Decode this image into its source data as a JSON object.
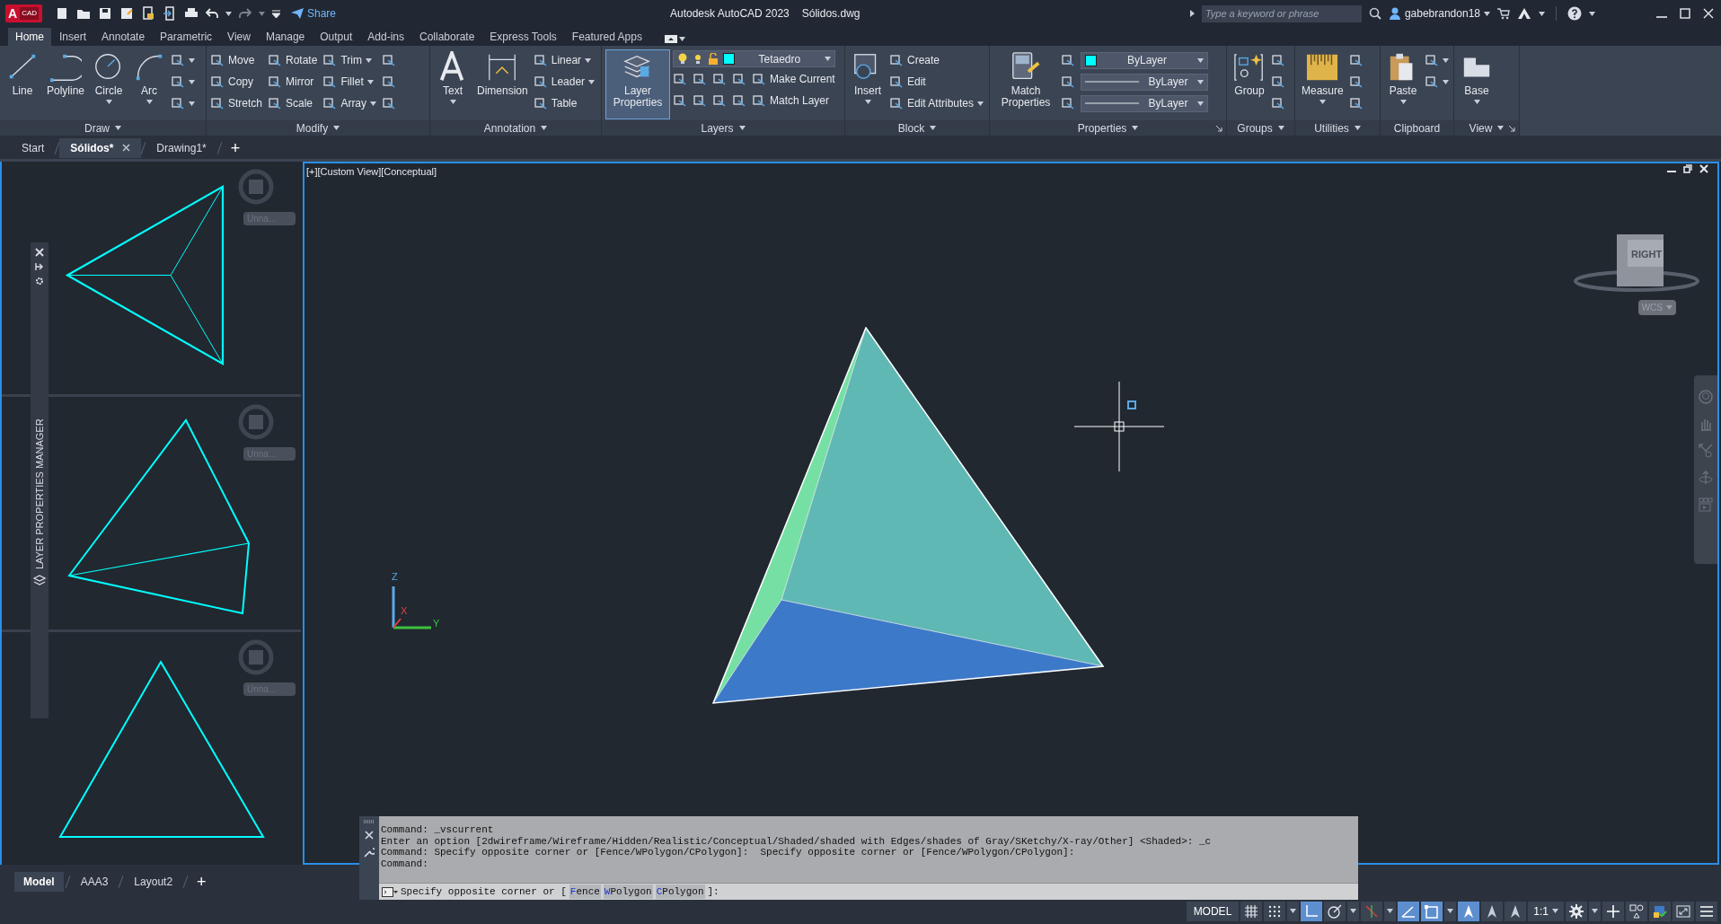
{
  "title_bar": {
    "app_letter": "A",
    "app_label": "CAD",
    "share": "Share",
    "title": "Autodesk AutoCAD 2023",
    "file": "Sólidos.dwg",
    "search_placeholder": "Type a keyword or phrase",
    "user": "gabebrandon18"
  },
  "ribbon_tabs": [
    {
      "label": "Home",
      "selected": true
    },
    {
      "label": "Insert",
      "selected": false
    },
    {
      "label": "Annotate",
      "selected": false
    },
    {
      "label": "Parametric",
      "selected": false
    },
    {
      "label": "View",
      "selected": false
    },
    {
      "label": "Manage",
      "selected": false
    },
    {
      "label": "Output",
      "selected": false
    },
    {
      "label": "Add-ins",
      "selected": false
    },
    {
      "label": "Collaborate",
      "selected": false
    },
    {
      "label": "Express Tools",
      "selected": false
    },
    {
      "label": "Featured Apps",
      "selected": false
    }
  ],
  "ribbon_panels": [
    {
      "title": "Draw",
      "title_dropdown": true,
      "launcher": false,
      "large": [
        {
          "label": "Line",
          "dropdown": false,
          "selected": false
        },
        {
          "label": "Polyline",
          "dropdown": false,
          "selected": false
        },
        {
          "label": "Circle",
          "dropdown": true,
          "selected": false
        },
        {
          "label": "Arc",
          "dropdown": true,
          "selected": false
        }
      ],
      "rows": [
        [
          {
            "kind": "icon",
            "dropdown": true
          }
        ],
        [
          {
            "kind": "icon",
            "dropdown": true
          }
        ],
        [
          {
            "kind": "icon",
            "dropdown": true
          }
        ]
      ]
    },
    {
      "title": "Modify",
      "title_dropdown": true,
      "launcher": false,
      "rows": [
        [
          {
            "kind": "tool",
            "label": "Move",
            "dropdown": false
          },
          {
            "kind": "tool",
            "label": "Rotate",
            "dropdown": false
          },
          {
            "kind": "tool",
            "label": "Trim",
            "dropdown": true
          },
          {
            "kind": "icon",
            "dropdown": false
          }
        ],
        [
          {
            "kind": "tool",
            "label": "Copy",
            "dropdown": false
          },
          {
            "kind": "tool",
            "label": "Mirror",
            "dropdown": false
          },
          {
            "kind": "tool",
            "label": "Fillet",
            "dropdown": true
          },
          {
            "kind": "icon",
            "dropdown": false
          }
        ],
        [
          {
            "kind": "tool",
            "label": "Stretch",
            "dropdown": false
          },
          {
            "kind": "tool",
            "label": "Scale",
            "dropdown": false
          },
          {
            "kind": "tool",
            "label": "Array",
            "dropdown": true
          },
          {
            "kind": "icon",
            "dropdown": false
          }
        ]
      ]
    },
    {
      "title": "Annotation",
      "title_dropdown": true,
      "launcher": false,
      "large": [
        {
          "label": "Text",
          "dropdown": true,
          "selected": false
        },
        {
          "label": "Dimension",
          "dropdown": false,
          "selected": false
        }
      ],
      "rows": [
        [
          {
            "kind": "tool",
            "label": "Linear",
            "dropdown": true
          }
        ],
        [
          {
            "kind": "tool",
            "label": "Leader",
            "dropdown": true
          }
        ],
        [
          {
            "kind": "tool",
            "label": "Table",
            "dropdown": false
          }
        ]
      ]
    },
    {
      "title": "Layers",
      "title_dropdown": true,
      "launcher": false,
      "large": [
        {
          "label": "Layer Properties",
          "dropdown": false,
          "selected": true
        }
      ],
      "rows": [
        [
          {
            "kind": "layer_combo",
            "label": "Tetaedro",
            "color": "#00ffff"
          }
        ],
        [
          {
            "kind": "icon",
            "dropdown": false
          },
          {
            "kind": "icon",
            "dropdown": false
          },
          {
            "kind": "icon",
            "dropdown": false
          },
          {
            "kind": "icon",
            "dropdown": false
          },
          {
            "kind": "tool",
            "label": "Make Current",
            "dropdown": false
          }
        ],
        [
          {
            "kind": "icon",
            "dropdown": false
          },
          {
            "kind": "icon",
            "dropdown": false
          },
          {
            "kind": "icon",
            "dropdown": false
          },
          {
            "kind": "icon",
            "dropdown": false
          },
          {
            "kind": "tool",
            "label": "Match Layer",
            "dropdown": false
          }
        ]
      ]
    },
    {
      "title": "Block",
      "title_dropdown": true,
      "launcher": false,
      "large": [
        {
          "label": "Insert",
          "dropdown": true,
          "selected": false
        }
      ],
      "rows": [
        [
          {
            "kind": "tool",
            "label": "Create",
            "dropdown": false
          }
        ],
        [
          {
            "kind": "tool",
            "label": "Edit",
            "dropdown": false
          }
        ],
        [
          {
            "kind": "tool",
            "label": "Edit Attributes",
            "dropdown": true
          }
        ]
      ]
    },
    {
      "title": "Properties",
      "title_dropdown": true,
      "launcher": true,
      "large": [
        {
          "label": "Match Properties",
          "dropdown": false,
          "selected": false
        }
      ],
      "rows": [
        [
          {
            "kind": "icon",
            "dropdown": false
          },
          {
            "kind": "combo",
            "label": "ByLayer",
            "color": "#00ffff"
          }
        ],
        [
          {
            "kind": "icon",
            "dropdown": false
          },
          {
            "kind": "line_combo",
            "label": "ByLayer"
          }
        ],
        [
          {
            "kind": "icon",
            "dropdown": false
          },
          {
            "kind": "line_combo",
            "label": "ByLayer"
          }
        ]
      ]
    },
    {
      "title": "Groups",
      "title_dropdown": true,
      "launcher": false,
      "large": [
        {
          "label": "Group",
          "dropdown": false,
          "selected": false
        }
      ],
      "rows": [
        [
          {
            "kind": "icon",
            "dropdown": false
          }
        ],
        [
          {
            "kind": "icon",
            "dropdown": false
          }
        ],
        [
          {
            "kind": "icon",
            "dropdown": false
          }
        ]
      ]
    },
    {
      "title": "Utilities",
      "title_dropdown": true,
      "launcher": false,
      "large": [
        {
          "label": "Measure",
          "dropdown": true,
          "selected": false
        }
      ],
      "rows": [
        [
          {
            "kind": "icon",
            "dropdown": false
          }
        ],
        [
          {
            "kind": "icon",
            "dropdown": false
          }
        ],
        [
          {
            "kind": "icon",
            "dropdown": false
          }
        ]
      ]
    },
    {
      "title": "Clipboard",
      "title_dropdown": false,
      "launcher": false,
      "large": [
        {
          "label": "Paste",
          "dropdown": true,
          "selected": false
        }
      ],
      "rows": [
        [
          {
            "kind": "icon",
            "dropdown": true
          }
        ],
        [
          {
            "kind": "icon",
            "dropdown": true
          }
        ]
      ]
    },
    {
      "title": "View",
      "title_dropdown": true,
      "launcher": true,
      "large": [
        {
          "label": "Base",
          "dropdown": true,
          "selected": false
        }
      ]
    }
  ],
  "document_tabs": [
    {
      "label": "Start",
      "selected": false,
      "closable": false
    },
    {
      "label": "Sólidos*",
      "selected": true,
      "closable": true
    },
    {
      "label": "Drawing1*",
      "selected": false,
      "closable": false
    }
  ],
  "new_tab": "+",
  "layer_palette": {
    "title": "LAYER PROPERTIES MANAGER"
  },
  "side_viewports": [
    {
      "view_menu": "Unna..."
    },
    {
      "view_menu": "Unna..."
    },
    {
      "view_menu": "Unna..."
    }
  ],
  "main_viewport": {
    "label": "[+][Custom View][Conceptual]",
    "viewcube_face": "RIGHT",
    "ucs_menu": "WCS",
    "ucs_axes": [
      "Z",
      "X",
      "Y"
    ]
  },
  "command_window": {
    "history": [
      "Command: _vscurrent",
      "Enter an option [2dwireframe/Wireframe/Hidden/Realistic/Conceptual/Shaded/shaded with Edges/shades of Gray/SKetchy/X-ray/Other] <Shaded>: _c",
      "Command: Specify opposite corner or [Fence/WPolygon/CPolygon]:  Specify opposite corner or [Fence/WPolygon/CPolygon]:",
      "Command:"
    ],
    "prompt": "Specify opposite corner or [",
    "options": [
      {
        "key": "F",
        "rest": "ence"
      },
      {
        "key": "W",
        "rest": "Polygon"
      },
      {
        "key": "C",
        "rest": "Polygon"
      }
    ],
    "prompt_end": "]:"
  },
  "layout_tabs": [
    {
      "label": "Model",
      "selected": true
    },
    {
      "label": "AAA3",
      "selected": false
    },
    {
      "label": "Layout2",
      "selected": false
    }
  ],
  "new_layout": "+",
  "status_bar": {
    "items": [
      {
        "kind": "label",
        "text": "MODEL"
      },
      {
        "kind": "toggle",
        "on": false
      },
      {
        "kind": "toggle",
        "on": false
      },
      {
        "kind": "caret"
      },
      {
        "kind": "toggle",
        "on": true
      },
      {
        "kind": "toggle",
        "on": false
      },
      {
        "kind": "caret"
      },
      {
        "kind": "toggle",
        "on": false
      },
      {
        "kind": "caret"
      },
      {
        "kind": "toggle",
        "on": true
      },
      {
        "kind": "toggle",
        "on": true
      },
      {
        "kind": "caret"
      },
      {
        "kind": "toggle",
        "on": true
      },
      {
        "kind": "toggle",
        "on": false
      },
      {
        "kind": "toggle",
        "on": false
      },
      {
        "kind": "scale",
        "text": "1:1"
      },
      {
        "kind": "button"
      },
      {
        "kind": "caret"
      },
      {
        "kind": "button"
      },
      {
        "kind": "button"
      },
      {
        "kind": "button"
      },
      {
        "kind": "button"
      },
      {
        "kind": "button"
      }
    ]
  }
}
